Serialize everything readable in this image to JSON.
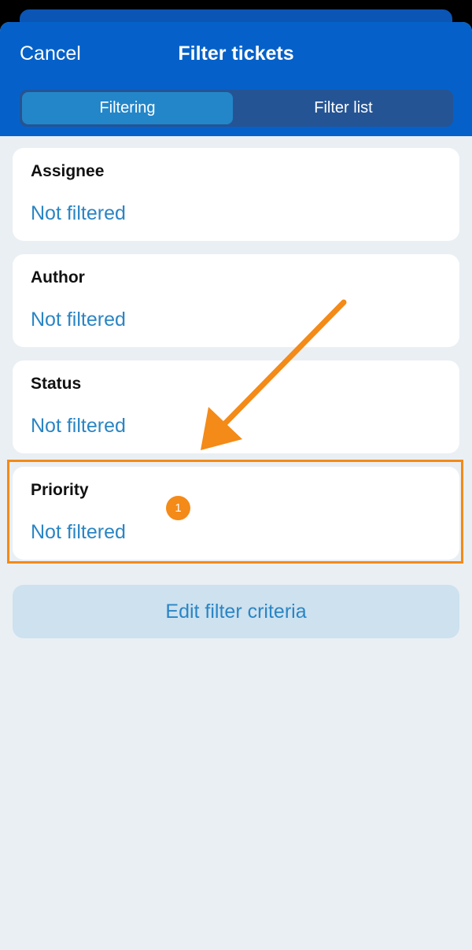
{
  "header": {
    "cancel_label": "Cancel",
    "title": "Filter tickets",
    "tabs": [
      {
        "label": "Filtering",
        "active": true
      },
      {
        "label": "Filter list",
        "active": false
      }
    ]
  },
  "filters": [
    {
      "label": "Assignee",
      "value": "Not filtered"
    },
    {
      "label": "Author",
      "value": "Not filtered"
    },
    {
      "label": "Status",
      "value": "Not filtered"
    },
    {
      "label": "Priority",
      "value": "Not filtered"
    }
  ],
  "annotation": {
    "step_number": "1"
  },
  "edit_button_label": "Edit filter criteria",
  "colors": {
    "header_blue": "#0561c9",
    "active_tab": "#2386c9",
    "link_blue": "#2a85c4",
    "highlight_orange": "#f48a17",
    "background": "#eaeff4"
  }
}
